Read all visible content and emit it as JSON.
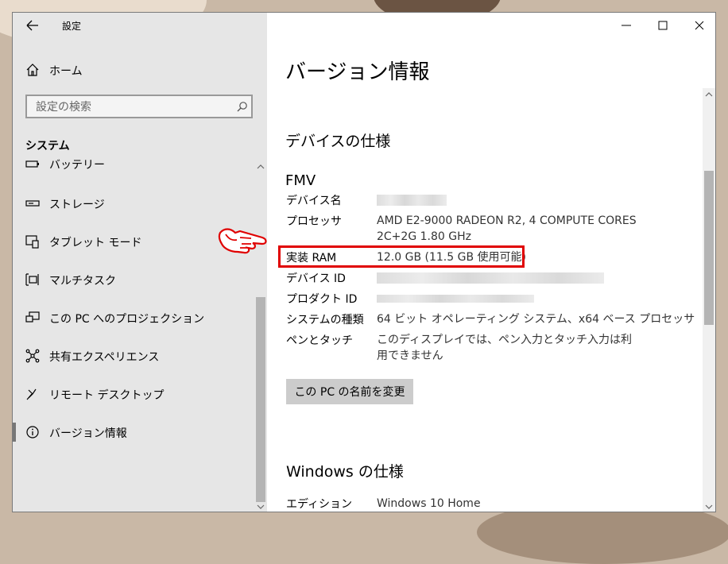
{
  "window": {
    "title": "設定",
    "minimize_icon": "minimize-icon",
    "maximize_icon": "maximize-icon",
    "close_icon": "close-icon"
  },
  "sidebar": {
    "home_label": "ホーム",
    "search_placeholder": "設定の検索",
    "section_title": "システム",
    "items": [
      {
        "label": "バッテリー",
        "icon": "battery-icon"
      },
      {
        "label": "ストレージ",
        "icon": "storage-icon"
      },
      {
        "label": "タブレット モード",
        "icon": "tablet-mode-icon"
      },
      {
        "label": "マルチタスク",
        "icon": "multitask-icon"
      },
      {
        "label": "この PC へのプロジェクション",
        "icon": "projection-icon"
      },
      {
        "label": "共有エクスペリエンス",
        "icon": "shared-experience-icon"
      },
      {
        "label": "リモート デスクトップ",
        "icon": "remote-desktop-icon"
      },
      {
        "label": "バージョン情報",
        "icon": "info-icon",
        "selected": true
      }
    ]
  },
  "main": {
    "page_title": "バージョン情報",
    "device_spec_heading": "デバイスの仕様",
    "device_model": "FMV",
    "specs": {
      "device_name_label": "デバイス名",
      "processor_label": "プロセッサ",
      "processor_value": "AMD E2-9000 RADEON R2, 4 COMPUTE CORES 2C+2G 1.80 GHz",
      "ram_label": "実装 RAM",
      "ram_value": "12.0 GB (11.5 GB 使用可能)",
      "device_id_label": "デバイス ID",
      "product_id_label": "プロダクト ID",
      "system_type_label": "システムの種類",
      "system_type_value": "64 ビット オペレーティング システム、x64 ベース プロセッサ",
      "pen_touch_label": "ペンとタッチ",
      "pen_touch_value": "このディスプレイでは、ペン入力とタッチ入力は利用できません"
    },
    "rename_button": "この PC の名前を変更",
    "windows_spec_heading": "Windows の仕様",
    "edition_label": "エディション",
    "edition_value": "Windows 10 Home"
  },
  "colors": {
    "highlight_red": "#e00000",
    "sidebar_bg": "#e6e6e6",
    "selected_bar": "#777777"
  }
}
